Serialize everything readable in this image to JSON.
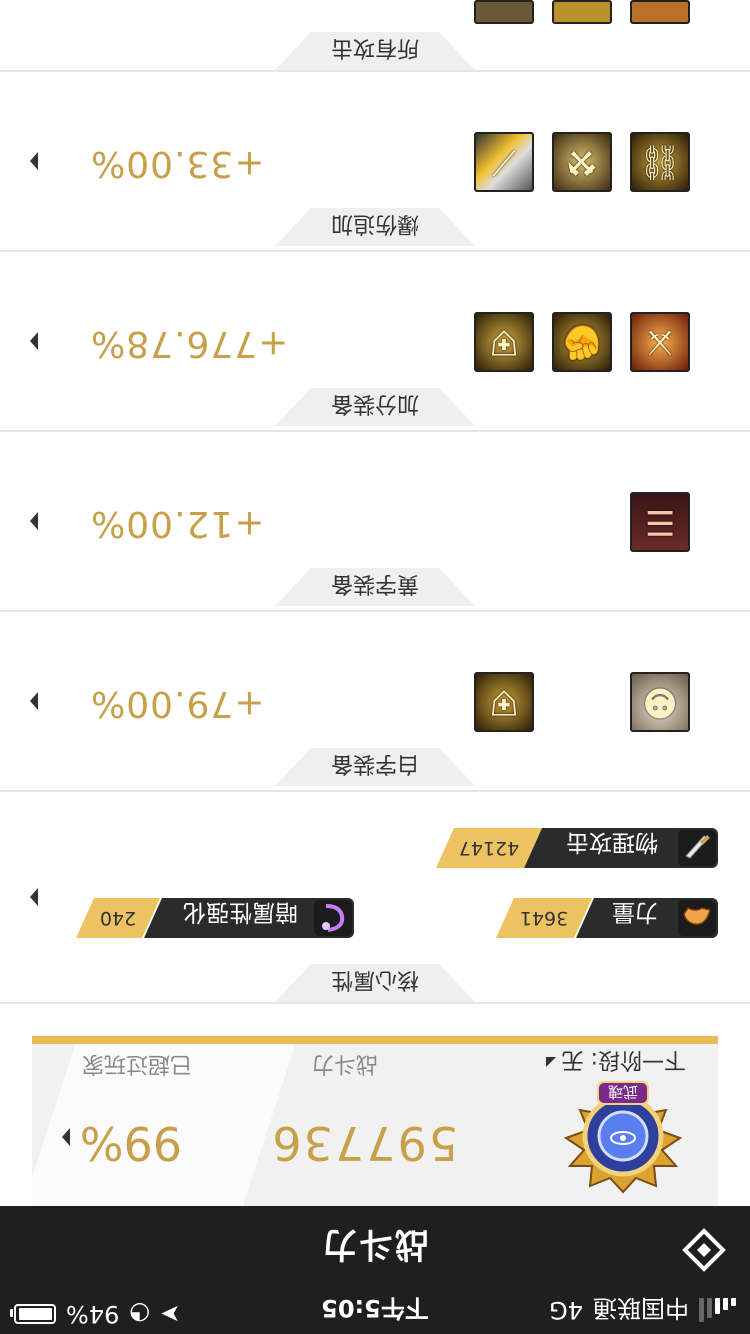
{
  "status_bar": {
    "carrier": "中国联通",
    "network": "4G",
    "time": "下午5:05",
    "battery_percent": "94%"
  },
  "header": {
    "title": "战斗力",
    "back_icon": "diamond-back-icon"
  },
  "power": {
    "stage_label": "下一阶段: 无",
    "emblem_text": "武魂",
    "value": "597736",
    "value_label": "战斗力",
    "percent": "99%",
    "percent_label": "已超过玩家"
  },
  "core": {
    "title": "核心属性",
    "attributes": [
      {
        "name": "物理攻击",
        "value": "42147",
        "icon": "sword-icon"
      },
      {
        "name": "力量",
        "value": "3641",
        "icon": "arm-icon"
      },
      {
        "name": "暗属性强化",
        "value": "240",
        "icon": "dark-ring-icon"
      }
    ]
  },
  "sections": [
    {
      "title": "白字装备",
      "value": "+79.00%",
      "items": [
        "item-armor-gold",
        "item-face-mask"
      ]
    },
    {
      "title": "黄字装备",
      "value": "+12.00%",
      "items": [
        "item-red-scroll"
      ]
    },
    {
      "title": "加分装备",
      "value": "+776.78%",
      "items": [
        "item-gold-chest",
        "item-gold-gauntlet",
        "item-red-blade"
      ]
    },
    {
      "title": "爆伤追加",
      "value": "+33.00%",
      "items": [
        "item-gold-blade",
        "item-gold-chain",
        "item-gold-belt"
      ]
    },
    {
      "title": "所有攻击",
      "value": "",
      "items": [
        "item-a",
        "item-b",
        "item-c"
      ]
    }
  ],
  "colors": {
    "gold": "#c8a04a",
    "accent_bar": "#e8bd55",
    "dark": "#1f1f1f"
  }
}
